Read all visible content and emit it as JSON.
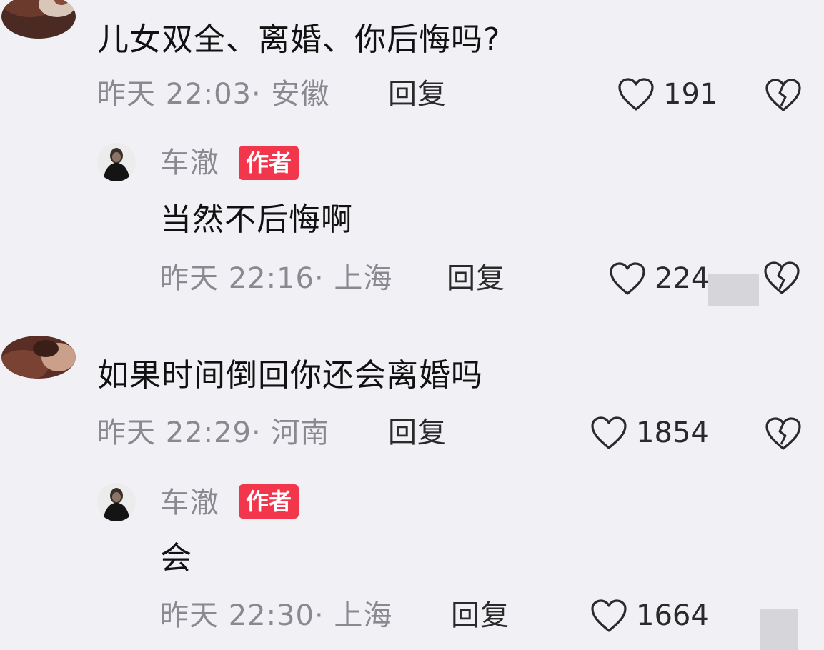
{
  "comments": [
    {
      "text": "儿女双全、离婚、你后悔吗?",
      "meta": "昨天 22:03· 安徽",
      "reply_label": "回复",
      "likes": "191",
      "icons": {
        "like": "heart-outline-icon",
        "dislike": "broken-heart-icon"
      },
      "author_reply": {
        "name": "车澈",
        "badge": "作者",
        "text": "当然不后悔啊",
        "meta": "昨天 22:16· 上海",
        "reply_label": "回复",
        "likes": "224"
      }
    },
    {
      "text": "如果时间倒回你还会离婚吗",
      "meta": "昨天 22:29· 河南",
      "reply_label": "回复",
      "likes": "1854",
      "icons": {
        "like": "heart-outline-icon",
        "dislike": "broken-heart-icon"
      },
      "author_reply": {
        "name": "车澈",
        "badge": "作者",
        "text": "会",
        "meta": "昨天 22:30· 上海",
        "reply_label": "回复",
        "likes": "1664"
      }
    }
  ],
  "colors": {
    "background": "#f1f0f4",
    "badge": "#f2374c",
    "meta_text": "#8a8990",
    "primary_text": "#111111"
  }
}
